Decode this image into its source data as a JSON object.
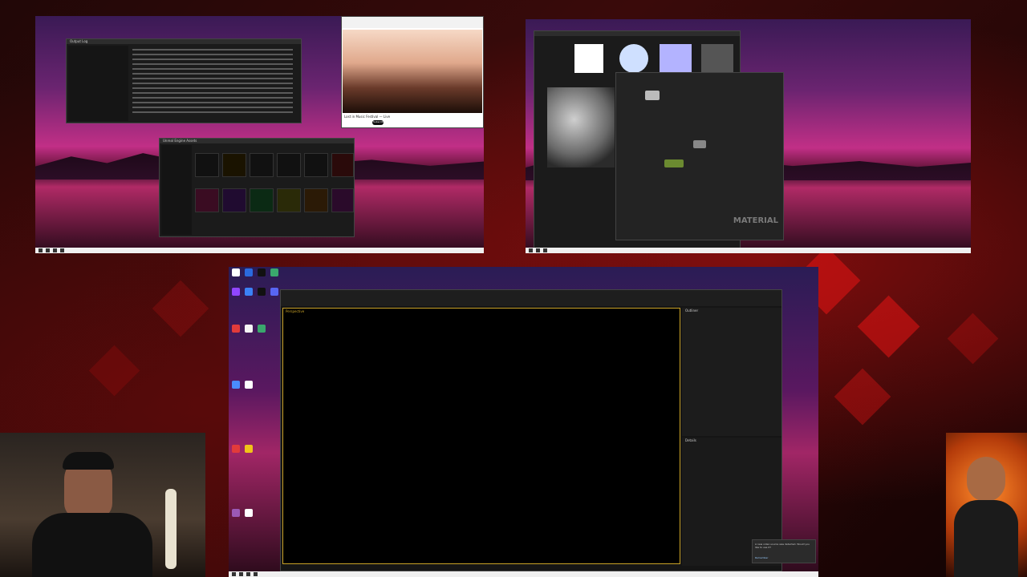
{
  "top_left_monitor": {
    "video_window": {
      "title": "Lost in Music Festival — Live",
      "subscribe_label": "Subscribe"
    },
    "file_browser": {
      "title": "Unreal Engine Assets"
    },
    "text_editor": {
      "title": "Output Log"
    }
  },
  "top_right_monitor": {
    "material_editor": {
      "watermark": "MATERIAL"
    }
  },
  "bottom_monitor": {
    "unreal_editor": {
      "viewport_label": "Perspective",
      "outliner_title": "Outliner",
      "details_title": "Details"
    },
    "notification": {
      "text": "A new video source was detected. Would you like to use it?",
      "action": "Remember"
    }
  },
  "webcams": {
    "left": "webcam-streamer",
    "right": "webcam-overlay"
  },
  "colors": {
    "background": "#210707",
    "accent_red": "#e61414",
    "editor_dark": "#1b1b1b",
    "viewport_border": "#c9a227"
  }
}
